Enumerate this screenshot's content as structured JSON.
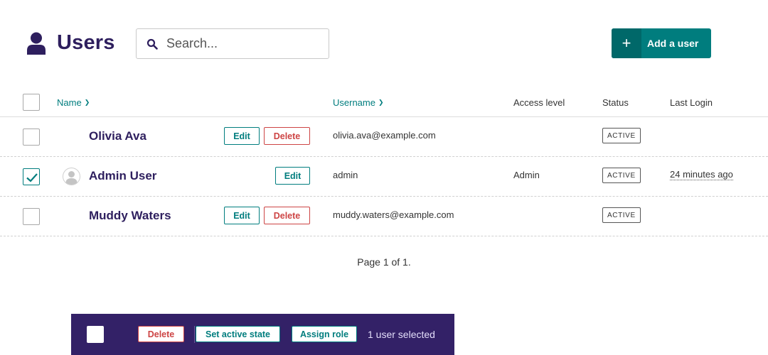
{
  "header": {
    "title": "Users",
    "title_icon": "user-icon",
    "search": {
      "placeholder": "Search...",
      "value": "",
      "icon": "search-icon"
    },
    "add_button": {
      "icon": "plus-icon",
      "label": "Add a user"
    }
  },
  "table": {
    "columns": {
      "name": "Name",
      "username": "Username",
      "access_level": "Access level",
      "status": "Status",
      "last_login": "Last Login"
    },
    "sort_icon": "chevron-down-icon",
    "rows": [
      {
        "checked": false,
        "has_avatar": false,
        "name": "Olivia Ava",
        "edit_label": "Edit",
        "delete_label": "Delete",
        "username": "olivia.ava@example.com",
        "access_level": "",
        "status": "ACTIVE",
        "last_login": ""
      },
      {
        "checked": true,
        "has_avatar": true,
        "name": "Admin User",
        "edit_label": "Edit",
        "delete_label": "",
        "username": "admin",
        "access_level": "Admin",
        "status": "ACTIVE",
        "last_login": "24 minutes ago"
      },
      {
        "checked": false,
        "has_avatar": false,
        "name": "Muddy Waters",
        "edit_label": "Edit",
        "delete_label": "Delete",
        "username": "muddy.waters@example.com",
        "access_level": "",
        "status": "ACTIVE",
        "last_login": ""
      }
    ]
  },
  "pagination": {
    "text": "Page 1 of 1."
  },
  "bulk_actions": {
    "select_all_checked": false,
    "delete_label": "Delete",
    "set_active_label": "Set active state",
    "assign_role_label": "Assign role",
    "selected_text": "1 user selected"
  },
  "colors": {
    "brand_dark": "#2e1f5e",
    "accent_teal": "#007d7e",
    "danger": "#cd4444",
    "bulk_bar_bg": "#332167"
  }
}
